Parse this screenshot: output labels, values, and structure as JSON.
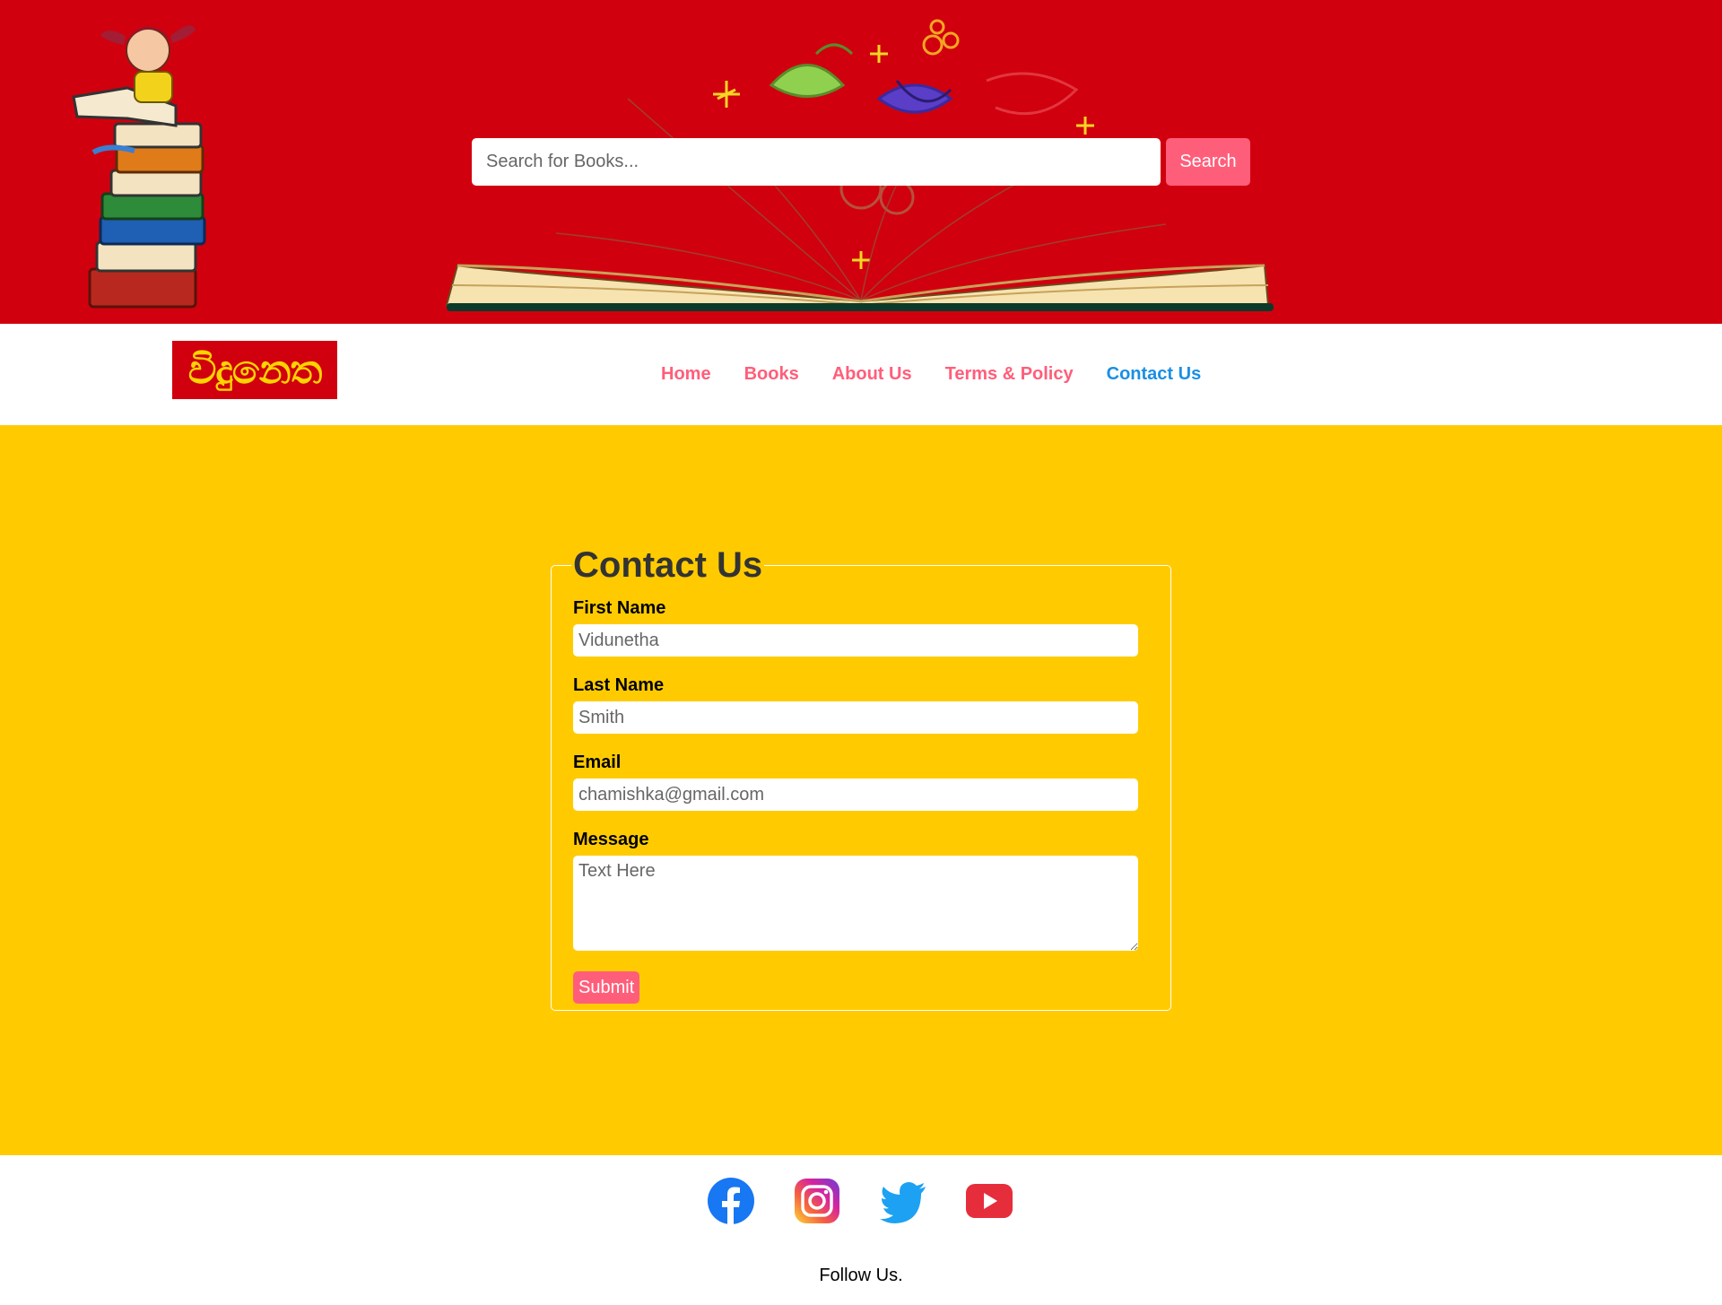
{
  "search": {
    "placeholder": "Search for Books...",
    "button_label": "Search"
  },
  "logo": {
    "text": "විදුනෙත"
  },
  "nav": {
    "items": [
      {
        "label": "Home",
        "active": false
      },
      {
        "label": "Books",
        "active": false
      },
      {
        "label": "About Us",
        "active": false
      },
      {
        "label": "Terms & Policy",
        "active": false
      },
      {
        "label": "Contact Us",
        "active": true
      }
    ]
  },
  "form": {
    "title": "Contact Us",
    "first_name": {
      "label": "First Name",
      "placeholder": "Vidunetha"
    },
    "last_name": {
      "label": "Last Name",
      "placeholder": "Smith"
    },
    "email": {
      "label": "Email",
      "placeholder": "chamishka@gmail.com"
    },
    "message": {
      "label": "Message",
      "placeholder": "Text Here"
    },
    "submit_label": "Submit"
  },
  "footer": {
    "socials": [
      {
        "icon": "facebook-icon",
        "color": "#1877f2"
      },
      {
        "icon": "instagram-icon",
        "color": "#d6249f"
      },
      {
        "icon": "twitter-icon",
        "color": "#1da1f2"
      },
      {
        "icon": "youtube-icon",
        "color": "#e62d3b"
      }
    ],
    "follow_text": "Follow Us."
  },
  "colors": {
    "banner_red": "#d1000f",
    "accent_pink": "#ff5e7a",
    "active_blue": "#1a8fe3",
    "main_yellow": "#ffcb00"
  }
}
